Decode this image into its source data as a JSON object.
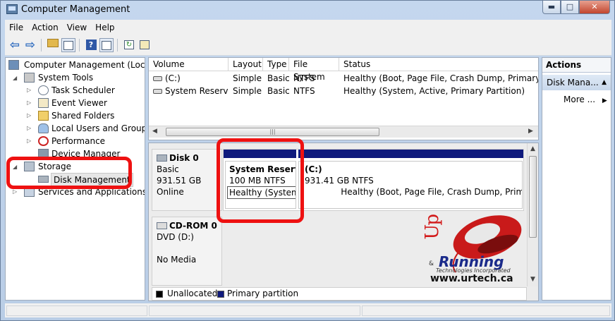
{
  "window": {
    "title": "Computer Management",
    "buttons": {
      "minimize": "▬",
      "maximize": "□",
      "close": "✕"
    }
  },
  "menu": [
    "File",
    "Action",
    "View",
    "Help"
  ],
  "tree": {
    "root": "Computer Management (Local)",
    "system_tools": "System Tools",
    "task_scheduler": "Task Scheduler",
    "event_viewer": "Event Viewer",
    "shared_folders": "Shared Folders",
    "local_users": "Local Users and Groups",
    "performance": "Performance",
    "device_manager": "Device Manager",
    "storage": "Storage",
    "disk_management": "Disk Management",
    "services": "Services and Applications"
  },
  "volumes": {
    "columns": [
      "Volume",
      "Layout",
      "Type",
      "File System",
      "Status"
    ],
    "rows": [
      {
        "volume": "(C:)",
        "layout": "Simple",
        "type": "Basic",
        "fs": "NTFS",
        "status": "Healthy (Boot, Page File, Crash Dump, Primary Partition)"
      },
      {
        "volume": "System Reserved",
        "layout": "Simple",
        "type": "Basic",
        "fs": "NTFS",
        "status": "Healthy (System, Active, Primary Partition)"
      }
    ],
    "scroll_glyph": "|||"
  },
  "disk0": {
    "name": "Disk 0",
    "kind": "Basic",
    "size": "931.51 GB",
    "state": "Online",
    "part1": {
      "label": "System Reserve",
      "size": "100 MB NTFS",
      "status": "Healthy (System, Active, Primary Partition)"
    },
    "part2": {
      "label": "(C:)",
      "size": "931.41 GB NTFS",
      "status": "Healthy (Boot, Page File, Crash Dump, Primary Partition)"
    }
  },
  "cdrom": {
    "name": "CD-ROM 0",
    "drive": "DVD (D:)",
    "media": "No Media"
  },
  "legend": {
    "unallocated": "Unallocated",
    "primary": "Primary partition",
    "unallocated_color": "#000000",
    "primary_color": "#0f1a7d"
  },
  "actions": {
    "header": "Actions",
    "section": "Disk Mana...",
    "more": "More ..."
  },
  "logo": {
    "up": "Up",
    "amp": "&",
    "running": "Running",
    "sub": "Technologies Incorporated",
    "url": "www.urtech.ca"
  },
  "colors": {
    "highlight_red": "#ee1111",
    "partition_blue": "#0f1a7d"
  }
}
